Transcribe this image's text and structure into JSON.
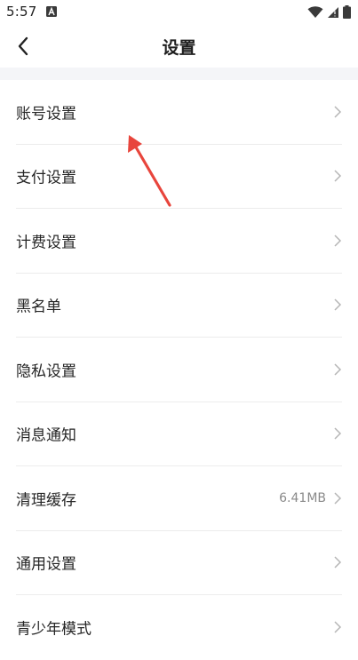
{
  "status_bar": {
    "time": "5:57",
    "notification_icon": "a-badge-icon",
    "wifi_icon": "wifi-icon",
    "signal_icon": "cell-signal-icon",
    "battery_icon": "battery-icon"
  },
  "header": {
    "title": "设置",
    "back_icon": "chevron-left-icon"
  },
  "settings": {
    "items": [
      {
        "label": "账号设置",
        "value": ""
      },
      {
        "label": "支付设置",
        "value": ""
      },
      {
        "label": "计费设置",
        "value": ""
      },
      {
        "label": "黑名单",
        "value": ""
      },
      {
        "label": "隐私设置",
        "value": ""
      },
      {
        "label": "消息通知",
        "value": ""
      },
      {
        "label": "清理缓存",
        "value": "6.41MB"
      },
      {
        "label": "通用设置",
        "value": ""
      },
      {
        "label": "青少年模式",
        "value": ""
      }
    ]
  },
  "colors": {
    "accent_arrow": "#e8453c",
    "separator": "#f4f5f8",
    "divider": "#ececec",
    "chevron": "#b5b5b5"
  }
}
